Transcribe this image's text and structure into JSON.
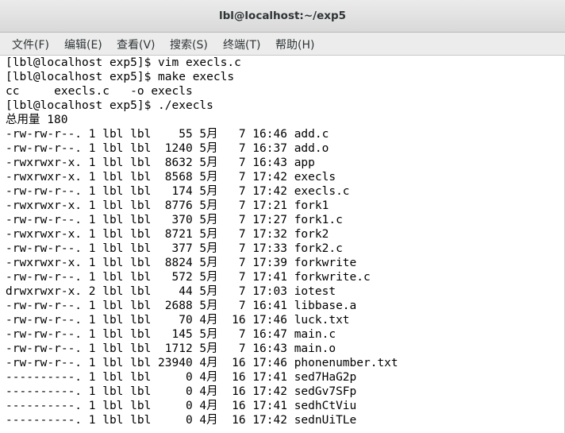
{
  "window": {
    "title": "lbl@localhost:~/exp5"
  },
  "menu": {
    "items": [
      {
        "label": "文件(F)"
      },
      {
        "label": "编辑(E)"
      },
      {
        "label": "查看(V)"
      },
      {
        "label": "搜索(S)"
      },
      {
        "label": "终端(T)"
      },
      {
        "label": "帮助(H)"
      }
    ]
  },
  "terminal": {
    "lines": [
      "[lbl@localhost exp5]$ vim execls.c",
      "[lbl@localhost exp5]$ make execls",
      "cc     execls.c   -o execls",
      "[lbl@localhost exp5]$ ./execls",
      "总用量 180",
      "-rw-rw-r--. 1 lbl lbl    55 5月   7 16:46 add.c",
      "-rw-rw-r--. 1 lbl lbl  1240 5月   7 16:37 add.o",
      "-rwxrwxr-x. 1 lbl lbl  8632 5月   7 16:43 app",
      "-rwxrwxr-x. 1 lbl lbl  8568 5月   7 17:42 execls",
      "-rw-rw-r--. 1 lbl lbl   174 5月   7 17:42 execls.c",
      "-rwxrwxr-x. 1 lbl lbl  8776 5月   7 17:21 fork1",
      "-rw-rw-r--. 1 lbl lbl   370 5月   7 17:27 fork1.c",
      "-rwxrwxr-x. 1 lbl lbl  8721 5月   7 17:32 fork2",
      "-rw-rw-r--. 1 lbl lbl   377 5月   7 17:33 fork2.c",
      "-rwxrwxr-x. 1 lbl lbl  8824 5月   7 17:39 forkwrite",
      "-rw-rw-r--. 1 lbl lbl   572 5月   7 17:41 forkwrite.c",
      "drwxrwxr-x. 2 lbl lbl    44 5月   7 17:03 iotest",
      "-rw-rw-r--. 1 lbl lbl  2688 5月   7 16:41 libbase.a",
      "-rw-rw-r--. 1 lbl lbl    70 4月  16 17:46 luck.txt",
      "-rw-rw-r--. 1 lbl lbl   145 5月   7 16:47 main.c",
      "-rw-rw-r--. 1 lbl lbl  1712 5月   7 16:43 main.o",
      "-rw-rw-r--. 1 lbl lbl 23940 4月  16 17:46 phonenumber.txt",
      "----------. 1 lbl lbl     0 4月  16 17:41 sed7HaG2p",
      "----------. 1 lbl lbl     0 4月  16 17:42 sedGv7SFp",
      "----------. 1 lbl lbl     0 4月  16 17:41 sedhCtViu",
      "----------. 1 lbl lbl     0 4月  16 17:42 sednUiTLe"
    ]
  }
}
